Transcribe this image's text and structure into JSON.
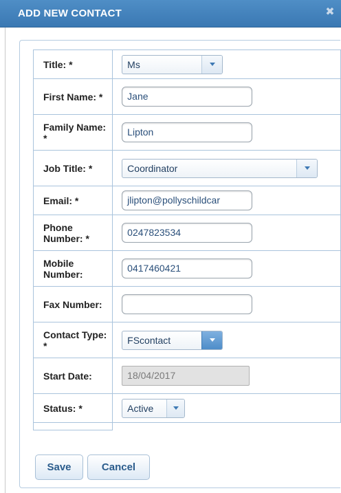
{
  "dialog": {
    "title": "ADD NEW CONTACT",
    "close_glyph": "✖"
  },
  "form": {
    "title": {
      "label": "Title: *",
      "value": "Ms"
    },
    "first_name": {
      "label": "First Name: *",
      "value": "Jane"
    },
    "family_name": {
      "label": "Family Name: *",
      "value": "Lipton"
    },
    "job_title": {
      "label": "Job Title: *",
      "value": "Coordinator"
    },
    "email": {
      "label": "Email: *",
      "value": "jlipton@pollyschildcar"
    },
    "phone": {
      "label": "Phone Number: *",
      "value": "0247823534"
    },
    "mobile": {
      "label": "Mobile Number:",
      "value": "0417460421"
    },
    "fax": {
      "label": "Fax Number:",
      "value": ""
    },
    "contact_type": {
      "label": "Contact Type: *",
      "value": "FScontact"
    },
    "start_date": {
      "label": "Start Date:",
      "value": "18/04/2017"
    },
    "status": {
      "label": "Status: *",
      "value": "Active"
    }
  },
  "buttons": {
    "save": "Save",
    "cancel": "Cancel"
  },
  "colors": {
    "titlebar": "#3a78b3",
    "border": "#a9c3dc",
    "accent": "#4e8dc9"
  }
}
